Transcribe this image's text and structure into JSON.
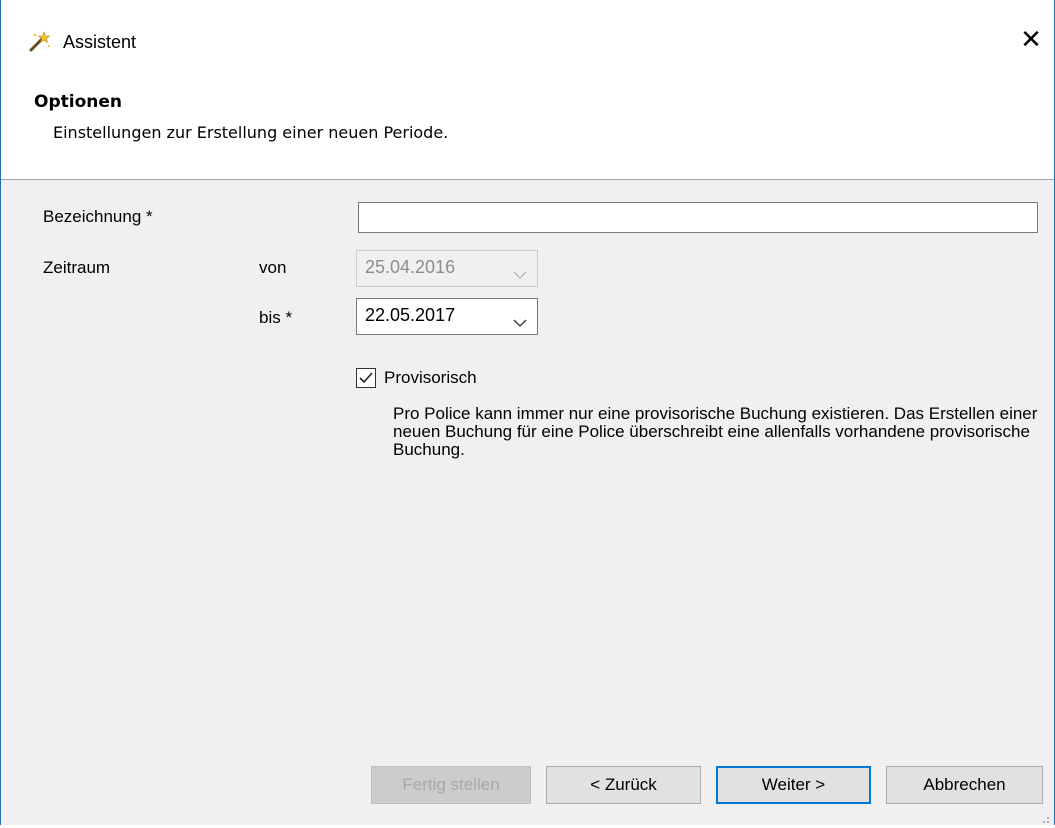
{
  "window": {
    "title": "Assistent",
    "icon": "wizard-wand-icon",
    "close_glyph": "✕"
  },
  "header": {
    "title": "Optionen",
    "subtitle": "Einstellungen zur Erstellung einer neuen Periode."
  },
  "form": {
    "bezeichnung_label": "Bezeichnung *",
    "bezeichnung_value": "",
    "zeitraum_label": "Zeitraum",
    "von_label": "von",
    "von_value": "25.04.2016",
    "bis_label": "bis *",
    "bis_value": "22.05.2017",
    "provisorisch_label": "Provisorisch",
    "provisorisch_checked": true,
    "note": "Pro Police kann immer nur eine provisorische Buchung existieren. Das Erstellen einer neuen Buchung für eine Police überschreibt eine allenfalls vorhandene provisorische Buchung."
  },
  "buttons": {
    "finish": "Fertig stellen",
    "back": "< Zurück",
    "next": "Weiter >",
    "cancel": "Abbrechen"
  }
}
